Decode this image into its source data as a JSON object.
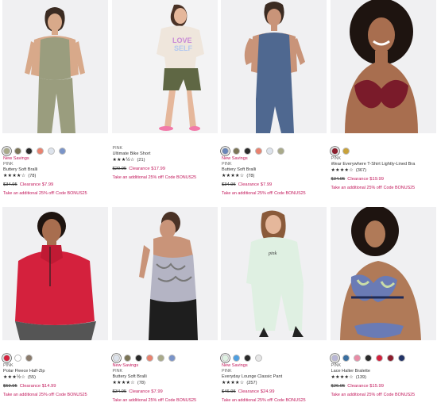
{
  "products": [
    {
      "swatches": [
        "#a9aa8a",
        "#7b7456",
        "#2a2a2a",
        "#e9826f",
        "#dde3ec",
        "#7a94c8"
      ],
      "selected_swatch": 0,
      "new_savings": "New Savings",
      "brand": "PINK",
      "name": "Buttery Soft Bralli",
      "stars": "★★★★☆",
      "reviews": "(78)",
      "orig_price": "$34.95",
      "sale_price": "Clearance $7.99",
      "promo": "Take an additional 25% off! Code BONUS25"
    },
    {
      "swatches": [],
      "selected_swatch": -1,
      "new_savings": "",
      "brand": "PINK",
      "name": "Ultimate Bike Short",
      "stars": "★★★½☆",
      "reviews": "(21)",
      "orig_price": "$29.95",
      "sale_price": "Clearance $17.99",
      "promo": "Take an additional 25% off! Code BONUS25"
    },
    {
      "swatches": [
        "#6a86b8",
        "#7b7456",
        "#2a2a2a",
        "#e9826f",
        "#dde3ec",
        "#a9aa8a"
      ],
      "selected_swatch": 0,
      "new_savings": "New Savings",
      "brand": "PINK",
      "name": "Buttery Soft Bralli",
      "stars": "★★★★☆",
      "reviews": "(78)",
      "orig_price": "$34.95",
      "sale_price": "Clearance $7.99",
      "promo": "Take an additional 25% off! Code BONUS25"
    },
    {
      "swatches": [
        "#8c1c2c",
        "#c8a23a"
      ],
      "selected_swatch": 0,
      "new_savings": "",
      "brand": "PINK",
      "name": "Wear Everywhere T-Shirt Lightly-Lined Bra",
      "stars": "★★★★☆",
      "reviews": "(367)",
      "orig_price": "$34.95",
      "sale_price": "Clearance $19.99",
      "promo": "Take an additional 25% off! Code BONUS25"
    },
    {
      "swatches": [
        "#d4213d",
        "#ffffff",
        "#8a7b6c"
      ],
      "selected_swatch": 0,
      "new_savings": "",
      "brand": "PINK",
      "name": "Polar Fleece Half-Zip",
      "stars": "★★★½☆",
      "reviews": "(55)",
      "orig_price": "$59.95",
      "sale_price": "Clearance $14.99",
      "promo": "Take an additional 25% off! Code BONUS25"
    },
    {
      "swatches": [
        "#dde3ec",
        "#7b7456",
        "#2a2a2a",
        "#e9826f",
        "#a9aa8a",
        "#7a94c8"
      ],
      "selected_swatch": 0,
      "new_savings": "New Savings",
      "brand": "PINK",
      "name": "Buttery Soft Bralli",
      "stars": "★★★★☆",
      "reviews": "(78)",
      "orig_price": "$34.95",
      "sale_price": "Clearance $7.99",
      "promo": "Take an additional 25% off! Code BONUS25"
    },
    {
      "swatches": [
        "#dff2e3",
        "#4f9fe0",
        "#2a2a2a",
        "#e6e6e6"
      ],
      "selected_swatch": 0,
      "new_savings": "New Savings",
      "brand": "PINK",
      "name": "Everyday Lounge Classic Pant",
      "stars": "★★★★☆",
      "reviews": "(257)",
      "orig_price": "$46.95",
      "sale_price": "Clearance $24.99",
      "promo": "Take an additional 25% off! Code BONUS25"
    },
    {
      "swatches": [
        "#b9b7d6",
        "#3b6fa0",
        "#e88ca6",
        "#2a2a2a",
        "#d4213d",
        "#8c1c2c",
        "#223366"
      ],
      "selected_swatch": 0,
      "new_savings": "",
      "brand": "PINK",
      "name": "Lace Halter Bralette",
      "stars": "★★★★☆",
      "reviews": "(139)",
      "orig_price": "$26.95",
      "sale_price": "Clearance $15.99",
      "promo": "Take an additional 25% off! Code BONUS25"
    }
  ]
}
